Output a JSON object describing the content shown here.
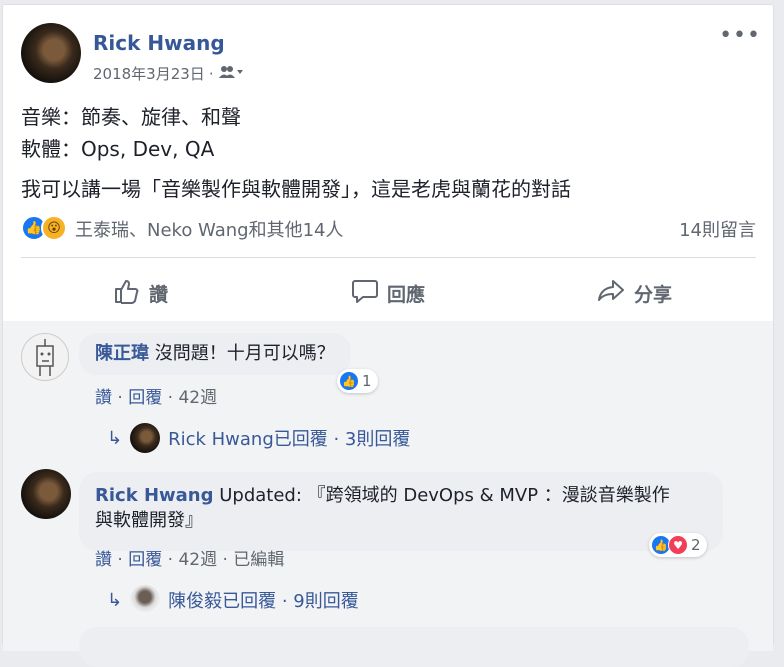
{
  "post": {
    "author": "Rick Hwang",
    "date": "2018年3月23日",
    "separator": "·",
    "lines": [
      "音樂：節奏、旋律、和聲",
      "軟體：Ops, Dev, QA",
      "我可以講一場「音樂製作與軟體開發」，這是老虎與蘭花的對話"
    ],
    "reactions_text": "王泰瑞、Neko Wang和其他14人",
    "comment_count": "14則留言"
  },
  "actions": {
    "like": "讚",
    "comment": "回應",
    "share": "分享"
  },
  "comments": [
    {
      "author": "陳正瑋",
      "text": "沒問題！十月可以嗎？",
      "like": "讚",
      "reply": "回覆",
      "age": "42週",
      "reaction_count": "1",
      "reply_summary": {
        "text": "Rick Hwang已回覆 · 3則回覆"
      }
    },
    {
      "author": "Rick Hwang",
      "text_line1": "Updated: 『跨領域的 DevOps & MVP ：漫談音樂製作",
      "text_line2": "與軟體開發』",
      "like": "讚",
      "reply": "回覆",
      "age": "42週",
      "edited": "已編輯",
      "reaction_count": "2",
      "reply_summary": {
        "text": "陳俊毅已回覆 · 9則回覆"
      }
    }
  ],
  "icons": {
    "audience": "friends-icon",
    "menu": "more-dots-icon",
    "like": "thumbs-up-icon",
    "comment": "speech-bubble-icon",
    "share": "share-arrow-icon"
  },
  "colors": {
    "link": "#365899",
    "like": "#1877f2",
    "love": "#f33e58"
  }
}
